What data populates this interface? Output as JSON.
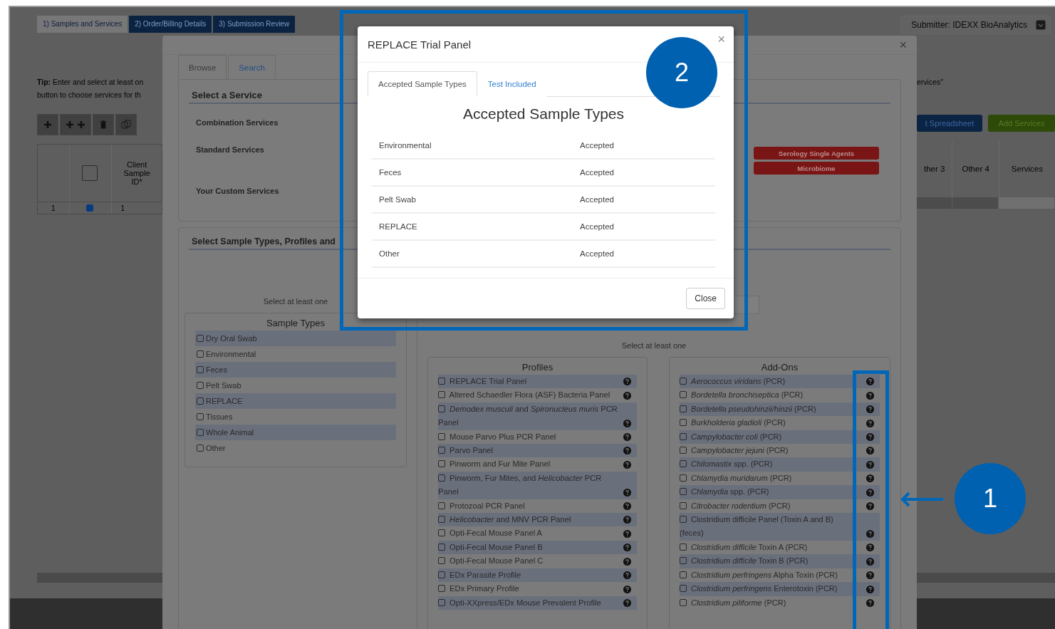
{
  "stepper": [
    {
      "label": "1) Samples and Services",
      "selected": true
    },
    {
      "label": "2) Order/Billing Details",
      "selected": false
    },
    {
      "label": "3) Submission Review",
      "selected": false
    }
  ],
  "submitter": "Submitter: IDEXX BioAnalytics",
  "tip_left": [
    "**Tip:** Enter and select at least on",
    "button to choose services for th"
  ],
  "tip_right": "ervices\"",
  "sample_table": {
    "select_all_checked": false,
    "column": "Client Sample ID*",
    "rows": [
      {
        "number": "1",
        "checked": true,
        "client_sample_id": "1"
      }
    ]
  },
  "right_buttons": [
    {
      "label": "t Spreadsheet",
      "kind": "primary"
    },
    {
      "label": "Add Services",
      "kind": "success"
    }
  ],
  "right_columns": [
    "ther 3",
    "Other 4",
    "Services"
  ],
  "service_modal": {
    "tabs": [
      {
        "label": "Browse",
        "selected": true
      },
      {
        "label": "Search",
        "selected": false
      }
    ],
    "select_service": {
      "title": "Select a Service",
      "categories": [
        "Combination Services",
        "Standard Services",
        "Your Custom Services"
      ],
      "buttons": [
        "Serology Single Agents",
        "Microbiome"
      ]
    },
    "sample_section": {
      "title": "Select Sample Types, Profiles and",
      "sample_hint": "Select at least one",
      "profile_hint": "Select at least one",
      "sample_types": {
        "title": "Sample Types",
        "items": [
          {
            "label": "Dry Oral Swab",
            "checked": false
          },
          {
            "label": "Environmental",
            "checked": false
          },
          {
            "label": "Feces",
            "checked": false
          },
          {
            "label": "Pelt Swab",
            "checked": false
          },
          {
            "label": "REPLACE",
            "checked": false
          },
          {
            "label": "Tissues",
            "checked": false
          },
          {
            "label": "Whole Animal",
            "checked": false
          },
          {
            "label": "Other",
            "checked": false
          }
        ]
      },
      "profiles": {
        "title": "Profiles",
        "items": [
          {
            "label": "REPLACE Trial Panel",
            "checked": false
          },
          {
            "label": "Altered Schaedler Flora (ASF) Bacteria Panel",
            "checked": false
          },
          {
            "label": "*Demodex musculi* and *Spironucleus muris* PCR Panel",
            "checked": false
          },
          {
            "label": "Mouse Parvo Plus PCR Panel",
            "checked": false
          },
          {
            "label": "Parvo Panel",
            "checked": false
          },
          {
            "label": "Pinworm and Fur Mite Panel",
            "checked": false
          },
          {
            "label": "Pinworm, Fur Mites, and *Helicobacter* PCR Panel",
            "checked": false
          },
          {
            "label": "Protozoal PCR Panel",
            "checked": false
          },
          {
            "label": "*Helicobacter* and MNV PCR Panel",
            "checked": false
          },
          {
            "label": "Opti-Fecal Mouse Panel A",
            "checked": false
          },
          {
            "label": "Opti-Fecal Mouse Panel B",
            "checked": false
          },
          {
            "label": "Opti-Fecal Mouse Panel C",
            "checked": false
          },
          {
            "label": "EDx Parasite Profile",
            "checked": false
          },
          {
            "label": "EDx Primary Profile",
            "checked": false
          },
          {
            "label": "Opti-XXpress/EDx Mouse Prevalent Profile",
            "checked": false
          }
        ]
      },
      "addons": {
        "title": "Add-Ons",
        "items": [
          {
            "label": "*Aerococcus viridans* (PCR)",
            "checked": false
          },
          {
            "label": "*Bordetella bronchiseptica* (PCR)",
            "checked": false
          },
          {
            "label": "*Bordetella pseudohinzii/hinzii* (PCR)",
            "checked": false
          },
          {
            "label": "*Burkholderia gladioli* (PCR)",
            "checked": false
          },
          {
            "label": "*Campylobacter coli* (PCR)",
            "checked": false
          },
          {
            "label": "*Campylobacter jejuni* (PCR)",
            "checked": false
          },
          {
            "label": "*Chilomastix* spp. (PCR)",
            "checked": false
          },
          {
            "label": "*Chlamydia muridarum* (PCR)",
            "checked": false
          },
          {
            "label": "*Chlamydia* spp. (PCR)",
            "checked": false
          },
          {
            "label": "*Citrobacter rodentium* (PCR)",
            "checked": false
          },
          {
            "label": "Clostridium difficile Panel (Toxin A and B) (feces)",
            "checked": false
          },
          {
            "label": "*Clostridium difficile* Toxin A (PCR)",
            "checked": false
          },
          {
            "label": "*Clostridium difficile* Toxin B (PCR)",
            "checked": false
          },
          {
            "label": "*Clostridium perfringens* Alpha Toxin (PCR)",
            "checked": false
          },
          {
            "label": "*Clostridium perfringens* Enterotoxin (PCR)",
            "checked": false
          },
          {
            "label": "*Clostridium piliforme* (PCR)",
            "checked": false
          }
        ]
      }
    }
  },
  "detail_modal": {
    "title": "REPLACE Trial Panel",
    "tabs": [
      {
        "label": "Accepted Sample Types",
        "selected": true
      },
      {
        "label": "Test Included",
        "selected": false
      }
    ],
    "heading": "Accepted Sample Types",
    "rows": [
      {
        "sample_type": "Environmental",
        "status": "Accepted"
      },
      {
        "sample_type": "Feces",
        "status": "Accepted"
      },
      {
        "sample_type": "Pelt Swab",
        "status": "Accepted"
      },
      {
        "sample_type": "REPLACE",
        "status": "Accepted"
      },
      {
        "sample_type": "Other",
        "status": "Accepted"
      }
    ],
    "close_button": "Close"
  },
  "callouts": [
    {
      "number": "1"
    },
    {
      "number": "2"
    }
  ],
  "close_glyph": "×"
}
